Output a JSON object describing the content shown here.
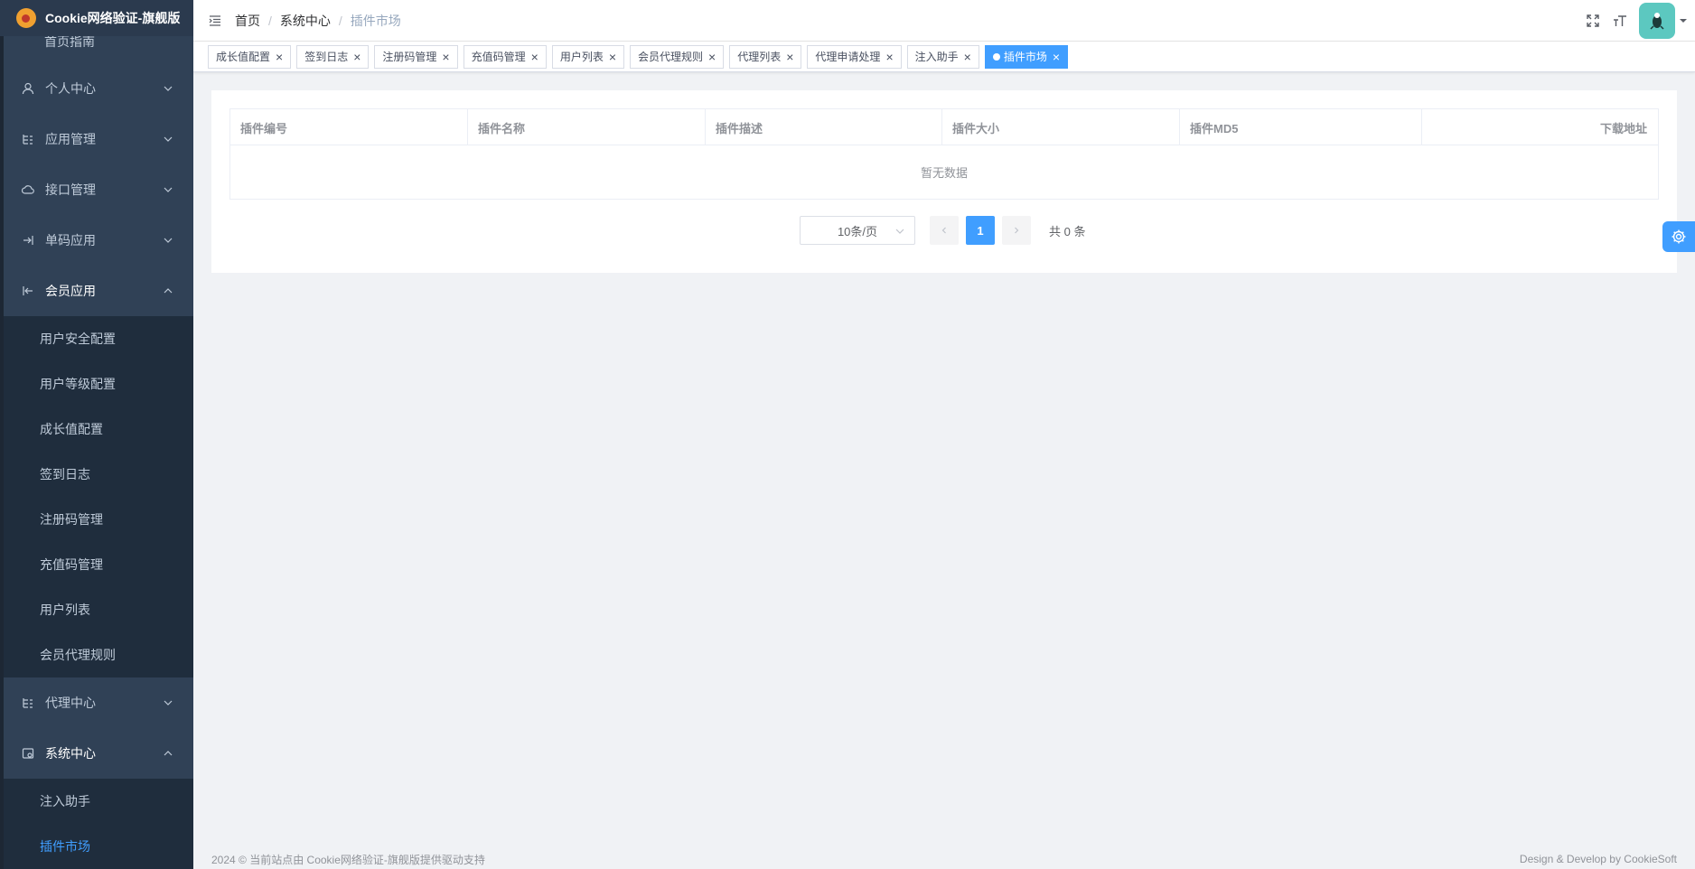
{
  "app": {
    "title": "Cookie网络验证-旗舰版"
  },
  "sidebar": {
    "partial_item": "首页指南",
    "menus": [
      {
        "label": "个人中心",
        "icon": "user-icon"
      },
      {
        "label": "应用管理",
        "icon": "tree-icon"
      },
      {
        "label": "接口管理",
        "icon": "cloud-icon"
      },
      {
        "label": "单码应用",
        "icon": "enter-icon"
      },
      {
        "label": "会员应用",
        "icon": "exit-icon"
      }
    ],
    "member_sub": [
      "用户安全配置",
      "用户等级配置",
      "成长值配置",
      "签到日志",
      "注册码管理",
      "充值码管理",
      "用户列表",
      "会员代理规则"
    ],
    "agent_center": "代理中心",
    "system_center": "系统中心",
    "system_sub": [
      "注入助手",
      "插件市场"
    ]
  },
  "breadcrumb": [
    "首页",
    "系统中心",
    "插件市场"
  ],
  "tags": [
    "成长值配置",
    "签到日志",
    "注册码管理",
    "充值码管理",
    "用户列表",
    "会员代理规则",
    "代理列表",
    "代理申请处理",
    "注入助手",
    "插件市场"
  ],
  "table": {
    "columns": [
      "插件编号",
      "插件名称",
      "插件描述",
      "插件大小",
      "插件MD5",
      "下载地址"
    ],
    "empty_text": "暂无数据"
  },
  "pagination": {
    "page_size_label": "10条/页",
    "current_page": "1",
    "total_label": "共 0 条"
  },
  "footer": {
    "left": "2024 © 当前站点由 Cookie网络验证-旗舰版提供驱动支持",
    "right": "Design & Develop by CookieSoft"
  },
  "colors": {
    "primary": "#409eff",
    "sidebar_bg": "#304156",
    "submenu_bg": "#1f2d3d"
  }
}
